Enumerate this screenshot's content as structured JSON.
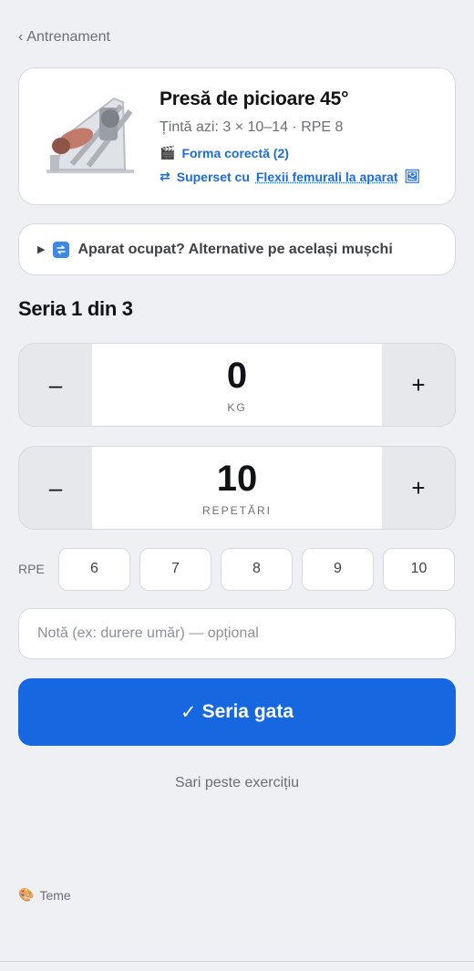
{
  "nav": {
    "back_chevron": "‹",
    "back_label": "Antrenament"
  },
  "exercise": {
    "image_icon": "leg-press-machine",
    "title": "Presă de picioare 45°",
    "target": "Țintă azi: 3 × 10–14 · RPE 8",
    "form_icon": "🎬",
    "form_link": "Forma corectă (2)",
    "superset_icon": "⇄",
    "superset_prefix": "Superset cu",
    "superset_name": "Flexii femurali la aparat",
    "superset_badge": "🖼"
  },
  "alternatives": {
    "caret": "▶",
    "label": "Aparat ocupat? Alternative pe același mușchi"
  },
  "set": {
    "heading": "Seria 1 din 3"
  },
  "weight": {
    "decrement": "–",
    "value": "0",
    "unit": "KG",
    "increment": "+"
  },
  "reps": {
    "decrement": "–",
    "value": "10",
    "unit": "REPETĂRI",
    "increment": "+"
  },
  "rpe": {
    "label": "RPE",
    "options": [
      "6",
      "7",
      "8",
      "9",
      "10"
    ]
  },
  "note": {
    "placeholder": "Notă (ex: durere umăr) — opțional",
    "value": ""
  },
  "actions": {
    "done_check": "✓",
    "done_label": "Seria gata",
    "skip_label": "Sari peste exercițiu"
  },
  "footer": {
    "themes_icon": "🎨",
    "themes_label": "Teme"
  },
  "colors": {
    "accent": "#1768e0",
    "link": "#1c6be0",
    "background": "#eef0f4"
  }
}
